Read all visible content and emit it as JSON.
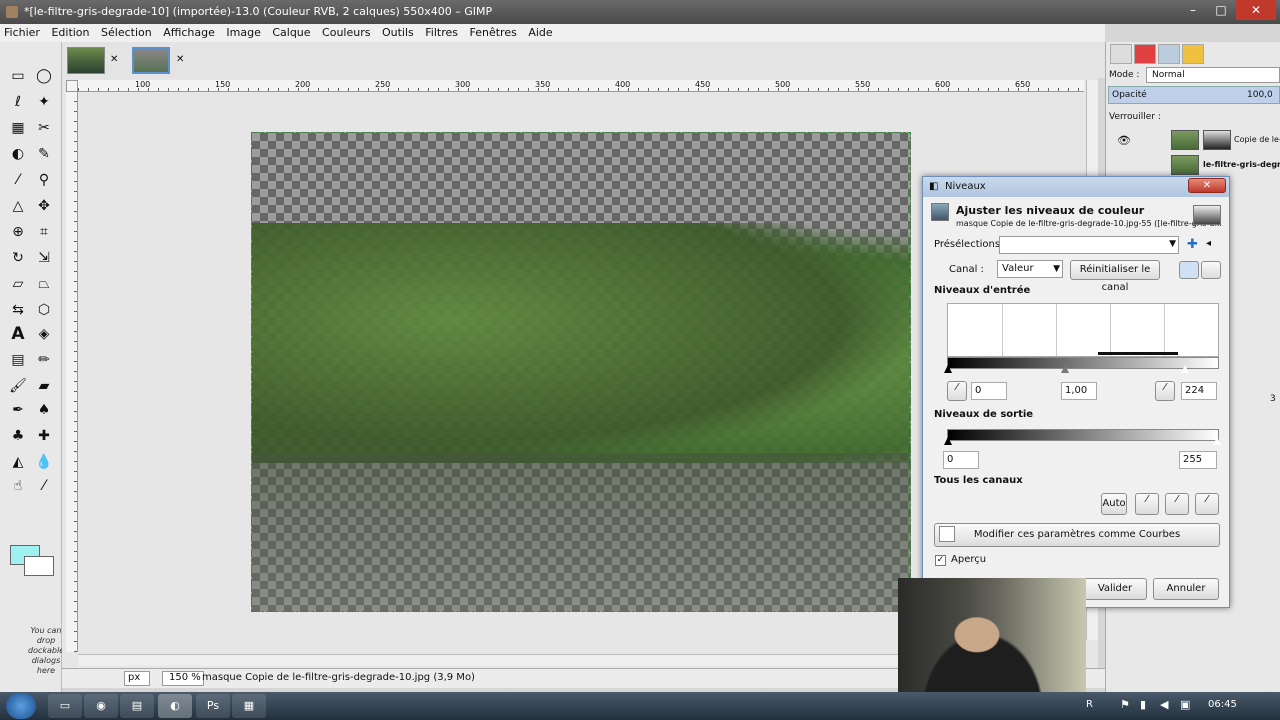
{
  "window": {
    "title": "*[le-filtre-gris-degrade-10] (importée)-13.0 (Couleur RVB, 2 calques) 550x400 – GIMP",
    "minimize": "–",
    "maximize": "□",
    "close": "✕"
  },
  "menu": [
    "Fichier",
    "Edition",
    "Sélection",
    "Affichage",
    "Image",
    "Calque",
    "Couleurs",
    "Outils",
    "Filtres",
    "Fenêtres",
    "Aide"
  ],
  "toolbox": {
    "dock_hint": "You can drop dockable dialogs here",
    "fg_color": "#9ff1f1",
    "bg_color": "#ffffff"
  },
  "rulers": [
    "100",
    "150",
    "200",
    "250",
    "300",
    "350",
    "400",
    "450",
    "500",
    "550",
    "600",
    "650"
  ],
  "statusbar": {
    "unit": "px",
    "zoom": "150 %",
    "message": "masque Copie de le-filtre-gris-degrade-10.jpg (3,9 Mo)"
  },
  "layers_dock": {
    "mode_label": "Mode :",
    "mode_value": "Normal",
    "opacity_label": "Opacité",
    "opacity_value": "100,0",
    "lock_label": "Verrouiller :",
    "layers": [
      {
        "name": "Copie de le-filt"
      },
      {
        "name": "le-filtre-gris-degrade"
      }
    ],
    "side_value": "3"
  },
  "levels": {
    "title": "Niveaux",
    "heading": "Ajuster les niveaux de couleur",
    "subheading": "masque Copie de le-filtre-gris-degrade-10.jpg-55 ([le-filtre-gris-d...",
    "presets_label": "Présélections :",
    "presets_value": "",
    "channel_label": "Canal :",
    "channel_value": "Valeur",
    "reset_channel": "Réinitialiser le canal",
    "input_levels_label": "Niveaux d'entrée",
    "input_low": "0",
    "input_gamma": "1,00",
    "input_high": "224",
    "output_levels_label": "Niveaux de sortie",
    "output_low": "0",
    "output_high": "255",
    "all_channels_label": "Tous les canaux",
    "auto": "Auto",
    "edit_as_curves": "Modifier ces paramètres comme Courbes",
    "preview_label": "Aperçu",
    "preview_checked": true,
    "ok": "Valider",
    "cancel": "Annuler"
  },
  "taskbar": {
    "clock": "06:45",
    "lang": "R"
  }
}
